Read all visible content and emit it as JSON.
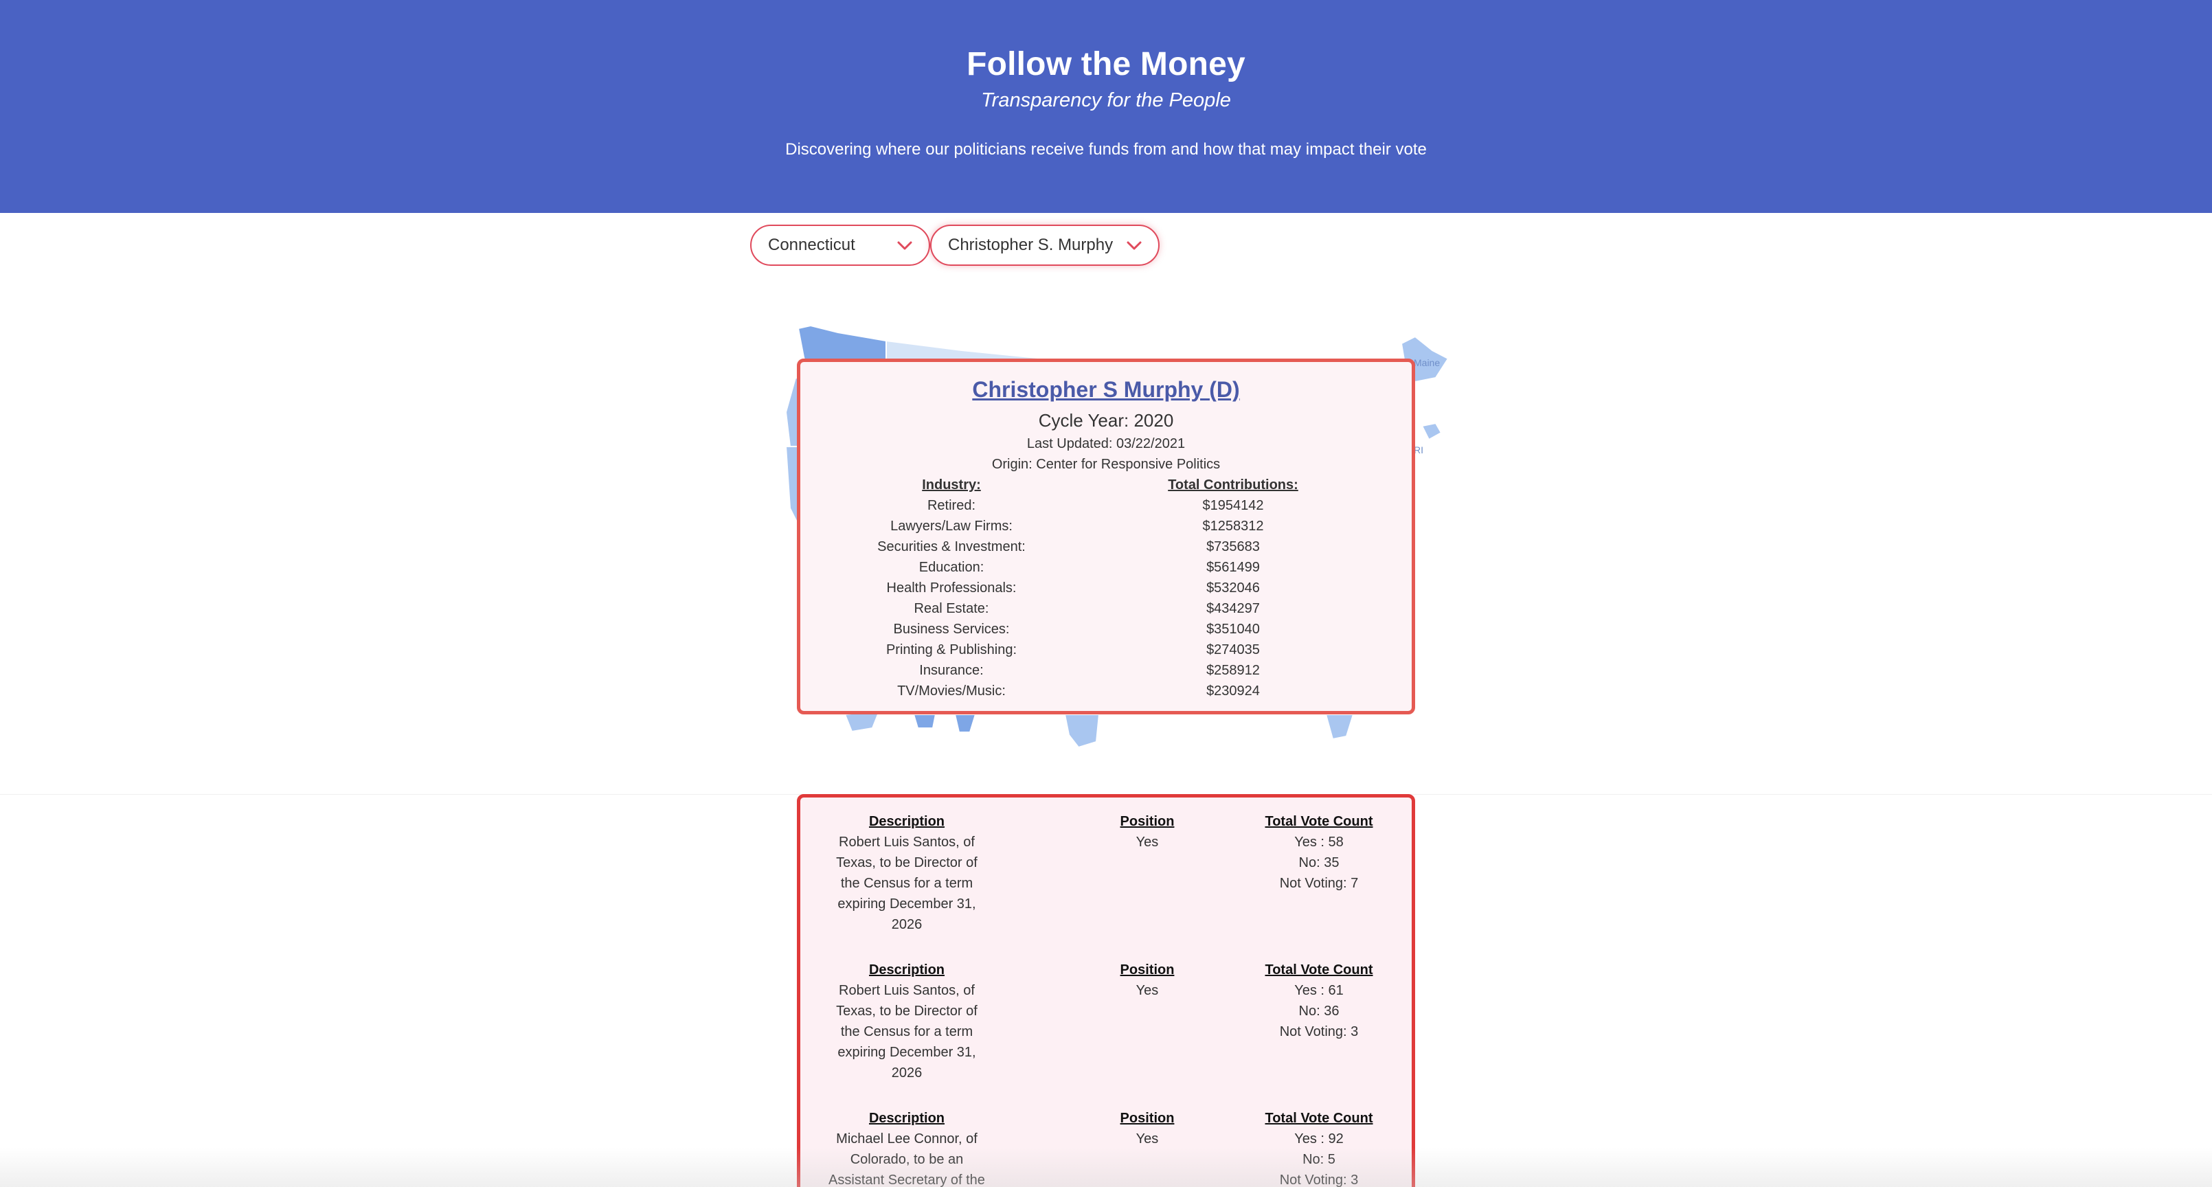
{
  "header": {
    "title": "Follow the Money",
    "tagline": "Transparency for the People",
    "description": "Discovering where our politicians receive funds from and how that may impact their vote"
  },
  "filters": {
    "state": "Connecticut",
    "politician": "Christopher S. Murphy"
  },
  "map": {
    "labels": [
      "Maine",
      "RI"
    ],
    "colors": {
      "dark": "#7ea6e6",
      "mid": "#a9c6f0",
      "light": "#d5e4f7"
    }
  },
  "profile": {
    "name": "Christopher S Murphy (D)",
    "cycle": "Cycle Year: 2020",
    "updated": "Last Updated: 03/22/2021",
    "origin": "Origin: Center for Responsive Politics",
    "industry_header": "Industry:",
    "total_header": "Total Contributions:",
    "contributions": [
      {
        "industry": "Retired:",
        "total": "$1954142"
      },
      {
        "industry": "Lawyers/Law Firms:",
        "total": "$1258312"
      },
      {
        "industry": "Securities & Investment:",
        "total": "$735683"
      },
      {
        "industry": "Education:",
        "total": "$561499"
      },
      {
        "industry": "Health Professionals:",
        "total": "$532046"
      },
      {
        "industry": "Real Estate:",
        "total": "$434297"
      },
      {
        "industry": "Business Services:",
        "total": "$351040"
      },
      {
        "industry": "Printing & Publishing:",
        "total": "$274035"
      },
      {
        "industry": "Insurance:",
        "total": "$258912"
      },
      {
        "industry": "TV/Movies/Music:",
        "total": "$230924"
      }
    ]
  },
  "votes": {
    "headers": {
      "description": "Description",
      "position": "Position",
      "count": "Total Vote Count"
    },
    "items": [
      {
        "description_lines": [
          "Robert Luis Santos, of",
          "Texas, to be Director of",
          "the Census for a term",
          "expiring December 31,",
          "2026"
        ],
        "position": "Yes",
        "yes": "Yes : 58",
        "no": "No: 35",
        "not_voting": "Not Voting: 7"
      },
      {
        "description_lines": [
          "Robert Luis Santos, of",
          "Texas, to be Director of",
          "the Census for a term",
          "expiring December 31,",
          "2026"
        ],
        "position": "Yes",
        "yes": "Yes : 61",
        "no": "No: 36",
        "not_voting": "Not Voting: 3"
      },
      {
        "description_lines": [
          "Michael Lee Connor, of",
          "Colorado, to be an",
          "Assistant Secretary of the"
        ],
        "position": "Yes",
        "yes": "Yes : 92",
        "no": "No: 5",
        "not_voting": "Not Voting: 3"
      }
    ]
  }
}
